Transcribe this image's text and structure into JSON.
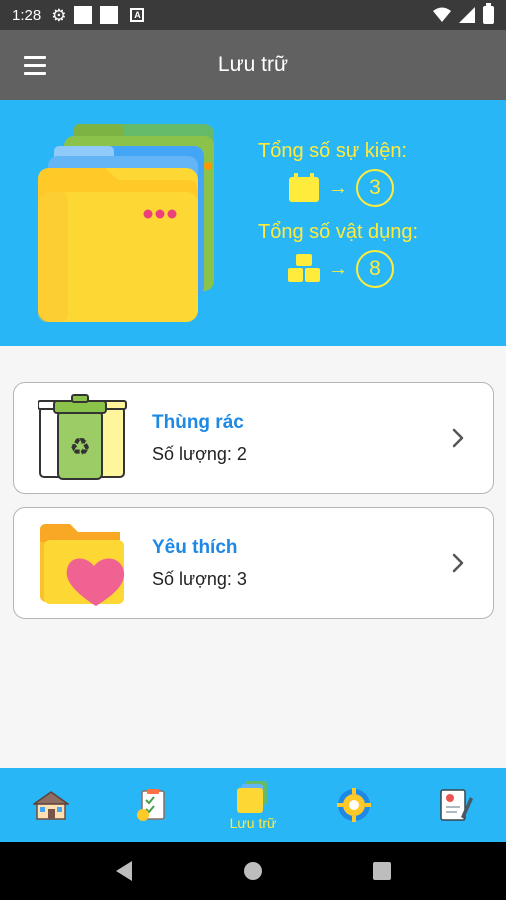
{
  "status_bar": {
    "time": "1:28",
    "icons": [
      "gear-icon",
      "square-icon",
      "square-icon",
      "a-box-icon",
      "wifi-icon",
      "signal-icon",
      "battery-icon"
    ]
  },
  "app_bar": {
    "title": "Lưu trữ",
    "menu_icon": "hamburger-icon"
  },
  "summary": {
    "events_label": "Tổng số sự kiện:",
    "events_count": "3",
    "items_label": "Tổng số vật dụng:",
    "items_count": "8",
    "arrow": "→"
  },
  "cards": [
    {
      "title": "Thùng rác",
      "count": "Số lượng: 2",
      "icon": "recycle-bins-icon"
    },
    {
      "title": "Yêu thích",
      "count": "Số lượng: 3",
      "icon": "heart-folder-icon"
    }
  ],
  "bottom_nav": {
    "items": [
      {
        "icon": "home-icon",
        "label": ""
      },
      {
        "icon": "checklist-icon",
        "label": ""
      },
      {
        "icon": "folders-icon",
        "label": "Lưu trữ",
        "active": true
      },
      {
        "icon": "settings-gear-icon",
        "label": ""
      },
      {
        "icon": "document-pen-icon",
        "label": ""
      }
    ]
  },
  "colors": {
    "banner": "#29b6f6",
    "accent_yellow": "#ffeb3b",
    "card_title": "#1e88e5",
    "app_bar": "#616161"
  }
}
